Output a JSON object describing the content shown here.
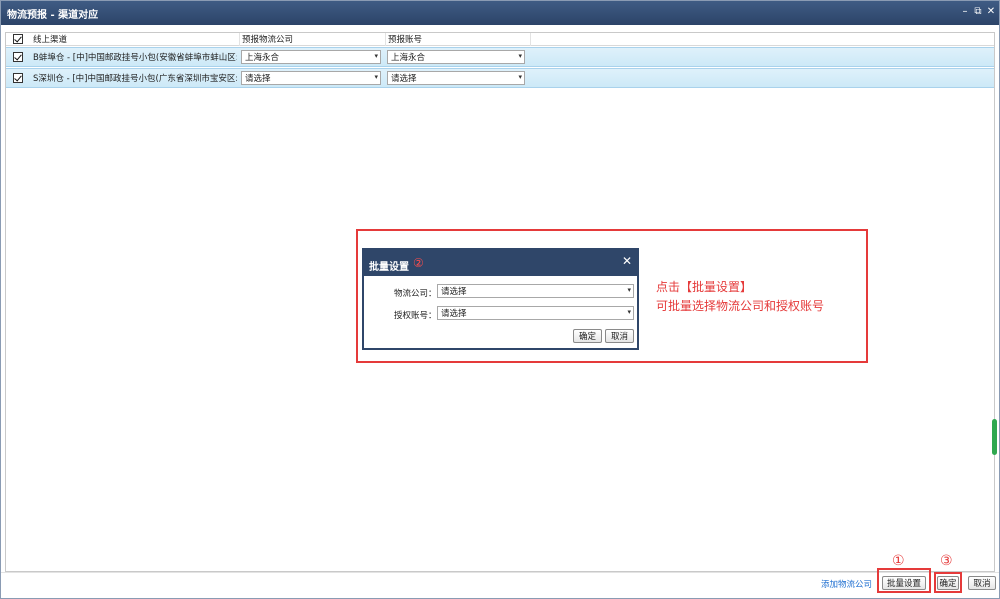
{
  "window": {
    "title": "物流预报 - 渠道对应",
    "min_glyph": "–",
    "restore_glyph": "⧉",
    "close_glyph": "✕"
  },
  "grid": {
    "columns": [
      "线上渠道",
      "预报物流公司",
      "预报账号"
    ],
    "rows": [
      {
        "checked": true,
        "channel": "B蚌埠仓 - [中]中国邮政挂号小包(安徽省蚌埠市蚌山区:",
        "company": "上海永合",
        "account": "上海永合"
      },
      {
        "checked": true,
        "channel": "S深圳仓 - [中]中国邮政挂号小包(广东省深圳市宝安区:",
        "company": "请选择",
        "account": "请选择"
      }
    ]
  },
  "dialog": {
    "title": "批量设置",
    "step": "②",
    "company_label": "物流公司：",
    "company_value": "请选择",
    "account_label": "授权账号：",
    "account_value": "请选择",
    "ok_label": "确定",
    "cancel_label": "取消"
  },
  "annotation": {
    "line1": "点击【批量设置】",
    "line2": "可批量选择物流公司和授权账号"
  },
  "footer": {
    "add_company_link": "添加物流公司",
    "batch_label": "批量设置",
    "ok_label": "确定",
    "cancel_label": "取消",
    "step1": "①",
    "step3": "③"
  },
  "colors": {
    "title_bar": "#2c4468",
    "row_highlight": "#cde9f7",
    "annotation_red": "#e53a3a",
    "link_blue": "#1f6fd1"
  }
}
